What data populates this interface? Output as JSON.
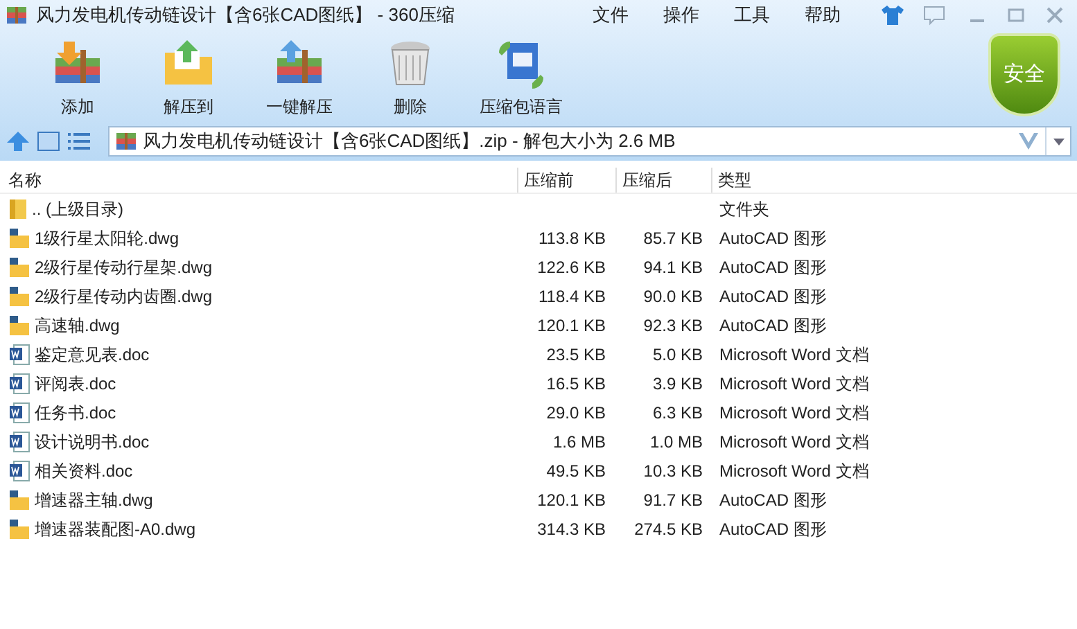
{
  "window": {
    "title": "风力发电机传动链设计【含6张CAD图纸】 - 360压缩"
  },
  "menu": [
    "文件",
    "操作",
    "工具",
    "帮助"
  ],
  "toolbar": [
    {
      "kind": "add",
      "label": "添加"
    },
    {
      "kind": "extract",
      "label": "解压到"
    },
    {
      "kind": "oneclick",
      "label": "一键解压"
    },
    {
      "kind": "delete",
      "label": "删除"
    },
    {
      "kind": "language",
      "label": "压缩包语言"
    }
  ],
  "security_badge": "安全",
  "address_bar": {
    "path": "风力发电机传动链设计【含6张CAD图纸】.zip - 解包大小为 2.6 MB"
  },
  "table": {
    "columns": [
      "名称",
      "压缩前",
      "压缩后",
      "类型"
    ],
    "rows": [
      {
        "kind": "folder",
        "name": ".. (上级目录)",
        "before": "",
        "after": "",
        "type": "文件夹"
      },
      {
        "kind": "dwg",
        "name": "1级行星太阳轮.dwg",
        "before": "113.8 KB",
        "after": "85.7 KB",
        "type": "AutoCAD 图形"
      },
      {
        "kind": "dwg",
        "name": "2级行星传动行星架.dwg",
        "before": "122.6 KB",
        "after": "94.1 KB",
        "type": "AutoCAD 图形"
      },
      {
        "kind": "dwg",
        "name": "2级行星传动内齿圈.dwg",
        "before": "118.4 KB",
        "after": "90.0 KB",
        "type": "AutoCAD 图形"
      },
      {
        "kind": "dwg",
        "name": "高速轴.dwg",
        "before": "120.1 KB",
        "after": "92.3 KB",
        "type": "AutoCAD 图形"
      },
      {
        "kind": "doc",
        "name": "鉴定意见表.doc",
        "before": "23.5 KB",
        "after": "5.0 KB",
        "type": "Microsoft Word 文档"
      },
      {
        "kind": "doc",
        "name": "评阅表.doc",
        "before": "16.5 KB",
        "after": "3.9 KB",
        "type": "Microsoft Word 文档"
      },
      {
        "kind": "doc",
        "name": "任务书.doc",
        "before": "29.0 KB",
        "after": "6.3 KB",
        "type": "Microsoft Word 文档"
      },
      {
        "kind": "doc",
        "name": "设计说明书.doc",
        "before": "1.6 MB",
        "after": "1.0 MB",
        "type": "Microsoft Word 文档"
      },
      {
        "kind": "doc",
        "name": "相关资料.doc",
        "before": "49.5 KB",
        "after": "10.3 KB",
        "type": "Microsoft Word 文档"
      },
      {
        "kind": "dwg",
        "name": "增速器主轴.dwg",
        "before": "120.1 KB",
        "after": "91.7 KB",
        "type": "AutoCAD 图形"
      },
      {
        "kind": "dwg",
        "name": "增速器装配图-A0.dwg",
        "before": "314.3 KB",
        "after": "274.5 KB",
        "type": "AutoCAD 图形"
      }
    ]
  }
}
